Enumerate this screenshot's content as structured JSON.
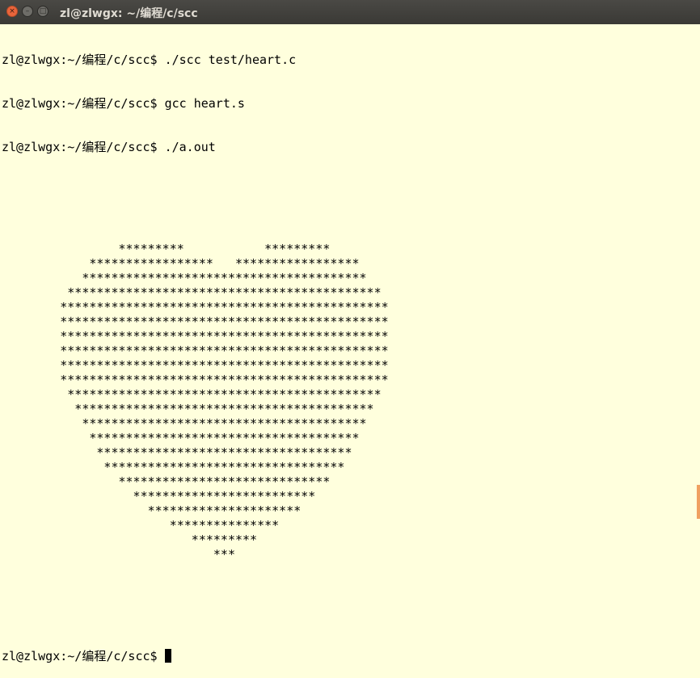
{
  "window": {
    "title": "zl@zlwgx: ~/编程/c/scc",
    "close": "×",
    "minimize": "–",
    "maximize": "□"
  },
  "terminal": {
    "commands": [
      "zl@zlwgx:~/编程/c/scc$ ./scc test/heart.c",
      "zl@zlwgx:~/编程/c/scc$ gcc heart.s",
      "zl@zlwgx:~/编程/c/scc$ ./a.out"
    ],
    "output": [
      "",
      "",
      "",
      "",
      "                *********           *********",
      "            *****************   *****************",
      "           ***************************************",
      "         *******************************************",
      "        *********************************************",
      "        *********************************************",
      "        *********************************************",
      "        *********************************************",
      "        *********************************************",
      "        *********************************************",
      "         *******************************************",
      "          *****************************************",
      "           ***************************************",
      "            *************************************",
      "             ***********************************",
      "              *********************************",
      "                *****************************",
      "                  *************************",
      "                    *********************",
      "                       ***************",
      "                          *********",
      "                             ***",
      "",
      "",
      "",
      ""
    ],
    "prompt": "zl@zlwgx:~/编程/c/scc$ "
  }
}
